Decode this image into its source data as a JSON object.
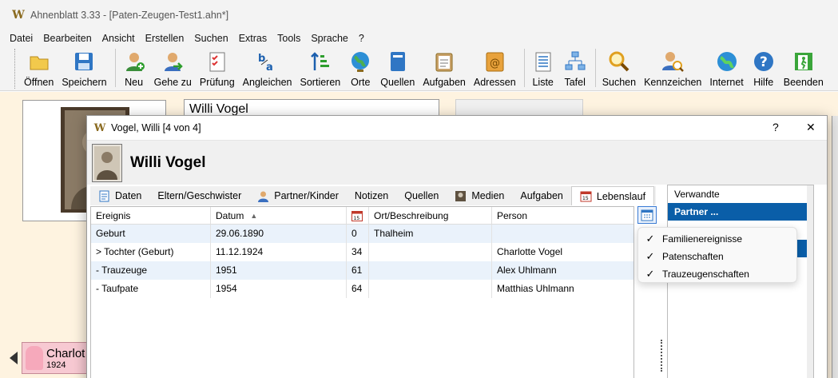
{
  "app": {
    "title": "Ahnenblatt 3.33 - [Paten-Zeugen-Test1.ahn*]"
  },
  "menu": [
    "Datei",
    "Bearbeiten",
    "Ansicht",
    "Erstellen",
    "Suchen",
    "Extras",
    "Tools",
    "Sprache",
    "?"
  ],
  "toolbar": [
    {
      "label": "Öffnen",
      "icon": "folder-open-icon"
    },
    {
      "label": "Speichern",
      "icon": "floppy-disk-icon"
    },
    {
      "label": "Neu",
      "icon": "add-person-icon"
    },
    {
      "label": "Gehe zu",
      "icon": "goto-person-icon"
    },
    {
      "label": "Prüfung",
      "icon": "checklist-icon"
    },
    {
      "label": "Angleichen",
      "icon": "align-text-icon"
    },
    {
      "label": "Sortieren",
      "icon": "sort-icon"
    },
    {
      "label": "Orte",
      "icon": "globe-icon"
    },
    {
      "label": "Quellen",
      "icon": "book-icon"
    },
    {
      "label": "Aufgaben",
      "icon": "clipboard-icon"
    },
    {
      "label": "Adressen",
      "icon": "address-book-icon"
    },
    {
      "label": "Liste",
      "icon": "list-icon"
    },
    {
      "label": "Tafel",
      "icon": "family-tree-icon"
    },
    {
      "label": "Suchen",
      "icon": "magnifier-icon"
    },
    {
      "label": "Kennzeichen",
      "icon": "person-search-icon"
    },
    {
      "label": "Internet",
      "icon": "internet-globe-icon"
    },
    {
      "label": "Hilfe",
      "icon": "help-icon"
    },
    {
      "label": "Beenden",
      "icon": "exit-icon"
    }
  ],
  "background": {
    "name_field": "Willi Vogel",
    "child_name": "Charlot",
    "child_year": "1924"
  },
  "dialog": {
    "title": "Vogel, Willi [4 von 4]",
    "help_label": "?",
    "close_label": "✕",
    "person_name": "Willi Vogel",
    "tabs": [
      {
        "label": "Daten",
        "icon": "document-icon"
      },
      {
        "label": "Eltern/Geschwister",
        "icon": ""
      },
      {
        "label": "Partner/Kinder",
        "icon": "person-icon"
      },
      {
        "label": "Notizen",
        "icon": ""
      },
      {
        "label": "Quellen",
        "icon": ""
      },
      {
        "label": "Medien",
        "icon": "photo-icon"
      },
      {
        "label": "Aufgaben",
        "icon": ""
      },
      {
        "label": "Lebenslauf",
        "icon": "calendar-icon"
      }
    ],
    "columns": [
      "Ereignis",
      "Datum",
      "",
      "Ort/Beschreibung",
      "Person"
    ],
    "rows": [
      {
        "event": "Geburt",
        "date": "29.06.1890",
        "age": "0",
        "place": "Thalheim",
        "person": ""
      },
      {
        "event": "> Tochter (Geburt)",
        "date": "11.12.1924",
        "age": "34",
        "place": "",
        "person": "Charlotte Vogel"
      },
      {
        "event": "- Trauzeuge",
        "date": "1951",
        "age": "61",
        "place": "",
        "person": "Alex Uhlmann"
      },
      {
        "event": "- Taufpate",
        "date": "1954",
        "age": "64",
        "place": "",
        "person": "Matthias Uhlmann"
      }
    ],
    "right_list": [
      {
        "label": "Verwandte",
        "selected": false
      },
      {
        "label": "Partner ...",
        "selected": true
      }
    ],
    "popup": [
      {
        "label": "Familienereignisse",
        "checked": true
      },
      {
        "label": "Patenschaften",
        "checked": true
      },
      {
        "label": "Trauzeugenschaften",
        "checked": true
      }
    ]
  },
  "colors": {
    "accent": "#0a5ea8",
    "row_alt": "#eaf2fb",
    "workspace": "#fef3e0",
    "child_card": "#f7c9d2"
  }
}
